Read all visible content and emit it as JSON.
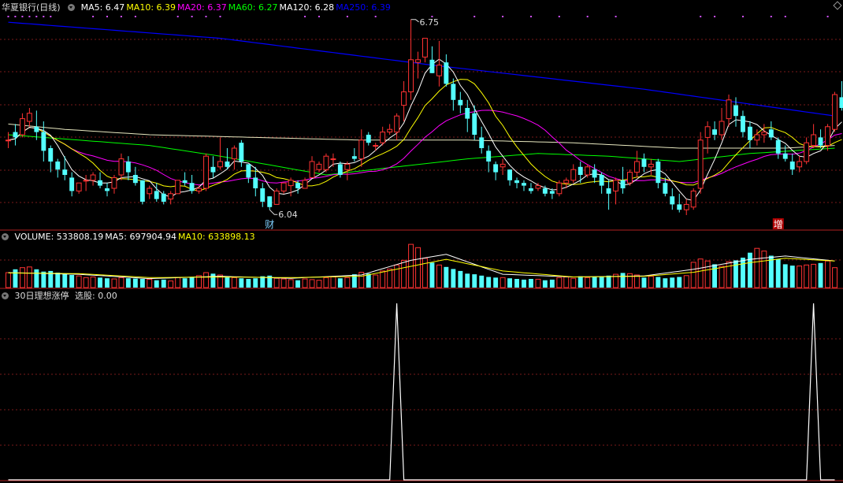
{
  "main": {
    "title": "华夏银行(日线)",
    "ma_labels": [
      {
        "name": "MA5: ",
        "value": "6.47",
        "color": "#ffffff"
      },
      {
        "name": "MA10: ",
        "value": "6.39",
        "color": "#ffff00"
      },
      {
        "name": "MA20: ",
        "value": "6.37",
        "color": "#ff00ff"
      },
      {
        "name": "MA60: ",
        "value": "6.27",
        "color": "#00ff00"
      },
      {
        "name": "MA120: ",
        "value": "6.28",
        "color": "#ffffff"
      },
      {
        "name": "MA250: ",
        "value": "6.39",
        "color": "#0000ff"
      }
    ]
  },
  "volume_panel": {
    "labels": [
      {
        "name": "VOLUME: ",
        "value": "533808.19",
        "color": "#ffffff"
      },
      {
        "name": "MA5: ",
        "value": "697904.94",
        "color": "#ffffff"
      },
      {
        "name": "MA10: ",
        "value": "633898.13",
        "color": "#ffff00"
      }
    ]
  },
  "indicator_panel": {
    "title": "30日理想涨停",
    "label": "选股: ",
    "value": "0.00"
  },
  "chart_data": [
    {
      "type": "candlestick",
      "x_count": 118,
      "annotations": [
        {
          "label": "6.75",
          "kind": "high",
          "index": 57
        },
        {
          "label": "6.04",
          "kind": "low",
          "index": 37
        },
        {
          "label": "财",
          "kind": "event",
          "index": 37
        },
        {
          "label": "增",
          "kind": "event",
          "index": 109
        }
      ],
      "colors": {
        "up": "#ff3232",
        "down": "#54ffff",
        "ma5": "#ffffff",
        "ma10": "#ffff00",
        "ma20": "#ff00ff",
        "ma60": "#00ff00",
        "ma120": "#ffffff",
        "ma250": "#0000ff"
      },
      "ohlc": [
        [
          6.3,
          6.33,
          6.27,
          6.3
        ],
        [
          6.33,
          6.36,
          6.28,
          6.31
        ],
        [
          6.32,
          6.4,
          6.31,
          6.38
        ],
        [
          6.37,
          6.42,
          6.35,
          6.4
        ],
        [
          6.35,
          6.41,
          6.3,
          6.33
        ],
        [
          6.33,
          6.37,
          6.22,
          6.26
        ],
        [
          6.27,
          6.28,
          6.18,
          6.22
        ],
        [
          6.22,
          6.23,
          6.16,
          6.19
        ],
        [
          6.19,
          6.24,
          6.15,
          6.17
        ],
        [
          6.16,
          6.18,
          6.09,
          6.11
        ],
        [
          6.11,
          6.14,
          6.1,
          6.14
        ],
        [
          6.15,
          6.17,
          6.11,
          6.15
        ],
        [
          6.15,
          6.18,
          6.13,
          6.17
        ],
        [
          6.15,
          6.18,
          6.12,
          6.13
        ],
        [
          6.12,
          6.14,
          6.09,
          6.11
        ],
        [
          6.12,
          6.17,
          6.1,
          6.16
        ],
        [
          6.17,
          6.25,
          6.15,
          6.23
        ],
        [
          6.22,
          6.24,
          6.15,
          6.18
        ],
        [
          6.17,
          6.2,
          6.13,
          6.14
        ],
        [
          6.15,
          6.15,
          6.06,
          6.07
        ],
        [
          6.1,
          6.13,
          6.08,
          6.12
        ],
        [
          6.11,
          6.14,
          6.07,
          6.08
        ],
        [
          6.1,
          6.11,
          6.06,
          6.07
        ],
        [
          6.08,
          6.11,
          6.06,
          6.1
        ],
        [
          6.1,
          6.15,
          6.1,
          6.15
        ],
        [
          6.15,
          6.18,
          6.13,
          6.14
        ],
        [
          6.14,
          6.17,
          6.1,
          6.11
        ],
        [
          6.11,
          6.13,
          6.1,
          6.12
        ],
        [
          6.12,
          6.25,
          6.11,
          6.24
        ],
        [
          6.2,
          6.24,
          6.16,
          6.18
        ],
        [
          6.2,
          6.31,
          6.19,
          6.22
        ],
        [
          6.22,
          6.27,
          6.19,
          6.2
        ],
        [
          6.23,
          6.28,
          6.19,
          6.27
        ],
        [
          6.29,
          6.3,
          6.2,
          6.22
        ],
        [
          6.21,
          6.21,
          6.14,
          6.16
        ],
        [
          6.16,
          6.2,
          6.09,
          6.12
        ],
        [
          6.12,
          6.14,
          6.05,
          6.07
        ],
        [
          6.09,
          6.09,
          6.04,
          6.05
        ],
        [
          6.06,
          6.12,
          6.06,
          6.11
        ],
        [
          6.11,
          6.14,
          6.1,
          6.14
        ],
        [
          6.13,
          6.16,
          6.09,
          6.15
        ],
        [
          6.14,
          6.15,
          6.1,
          6.12
        ],
        [
          6.12,
          6.16,
          6.12,
          6.15
        ],
        [
          6.16,
          6.24,
          6.16,
          6.22
        ],
        [
          6.19,
          6.22,
          6.18,
          6.21
        ],
        [
          6.19,
          6.25,
          6.18,
          6.24
        ],
        [
          6.23,
          6.25,
          6.2,
          6.23
        ],
        [
          6.21,
          6.22,
          6.16,
          6.17
        ],
        [
          6.19,
          6.22,
          6.15,
          6.21
        ],
        [
          6.24,
          6.27,
          6.22,
          6.23
        ],
        [
          6.23,
          6.34,
          6.2,
          6.3
        ],
        [
          6.32,
          6.33,
          6.28,
          6.29
        ],
        [
          6.28,
          6.29,
          6.26,
          6.28
        ],
        [
          6.29,
          6.35,
          6.28,
          6.33
        ],
        [
          6.33,
          6.36,
          6.32,
          6.34
        ],
        [
          6.33,
          6.4,
          6.3,
          6.39
        ],
        [
          6.43,
          6.52,
          6.37,
          6.48
        ],
        [
          6.48,
          6.75,
          6.45,
          6.6
        ],
        [
          6.59,
          6.63,
          6.53,
          6.6
        ],
        [
          6.61,
          6.68,
          6.59,
          6.68
        ],
        [
          6.6,
          6.65,
          6.55,
          6.55
        ],
        [
          6.54,
          6.67,
          6.5,
          6.58
        ],
        [
          6.59,
          6.62,
          6.5,
          6.51
        ],
        [
          6.51,
          6.53,
          6.41,
          6.45
        ],
        [
          6.45,
          6.48,
          6.4,
          6.43
        ],
        [
          6.42,
          6.45,
          6.33,
          6.38
        ],
        [
          6.4,
          6.43,
          6.3,
          6.32
        ],
        [
          6.31,
          6.35,
          6.25,
          6.27
        ],
        [
          6.26,
          6.28,
          6.18,
          6.22
        ],
        [
          6.21,
          6.22,
          6.15,
          6.18
        ],
        [
          6.2,
          6.23,
          6.17,
          6.21
        ],
        [
          6.19,
          6.19,
          6.13,
          6.15
        ],
        [
          6.15,
          6.16,
          6.12,
          6.14
        ],
        [
          6.14,
          6.15,
          6.11,
          6.13
        ],
        [
          6.12,
          6.14,
          6.1,
          6.11
        ],
        [
          6.12,
          6.14,
          6.11,
          6.13
        ],
        [
          6.12,
          6.13,
          6.09,
          6.1
        ],
        [
          6.11,
          6.12,
          6.08,
          6.1
        ],
        [
          6.1,
          6.15,
          6.09,
          6.14
        ],
        [
          6.14,
          6.16,
          6.12,
          6.15
        ],
        [
          6.15,
          6.21,
          6.14,
          6.19
        ],
        [
          6.2,
          6.22,
          6.14,
          6.17
        ],
        [
          6.17,
          6.21,
          6.16,
          6.2
        ],
        [
          6.19,
          6.21,
          6.14,
          6.16
        ],
        [
          6.17,
          6.18,
          6.1,
          6.13
        ],
        [
          6.12,
          6.15,
          6.04,
          6.1
        ],
        [
          6.11,
          6.16,
          6.06,
          6.15
        ],
        [
          6.15,
          6.2,
          6.1,
          6.12
        ],
        [
          6.14,
          6.19,
          6.13,
          6.18
        ],
        [
          6.18,
          6.26,
          6.16,
          6.22
        ],
        [
          6.23,
          6.25,
          6.18,
          6.2
        ],
        [
          6.2,
          6.23,
          6.17,
          6.21
        ],
        [
          6.22,
          6.23,
          6.12,
          6.14
        ],
        [
          6.14,
          6.16,
          6.09,
          6.1
        ],
        [
          6.09,
          6.12,
          6.04,
          6.06
        ],
        [
          6.06,
          6.1,
          6.03,
          6.04
        ],
        [
          6.04,
          6.08,
          6.02,
          6.06
        ],
        [
          6.05,
          6.12,
          6.04,
          6.11
        ],
        [
          6.12,
          6.33,
          6.1,
          6.3
        ],
        [
          6.31,
          6.37,
          6.25,
          6.35
        ],
        [
          6.34,
          6.37,
          6.3,
          6.32
        ],
        [
          6.32,
          6.42,
          6.3,
          6.37
        ],
        [
          6.38,
          6.47,
          6.35,
          6.45
        ],
        [
          6.43,
          6.46,
          6.35,
          6.39
        ],
        [
          6.39,
          6.41,
          6.31,
          6.33
        ],
        [
          6.35,
          6.37,
          6.27,
          6.3
        ],
        [
          6.3,
          6.34,
          6.28,
          6.32
        ],
        [
          6.32,
          6.36,
          6.29,
          6.33
        ],
        [
          6.34,
          6.37,
          6.3,
          6.31
        ],
        [
          6.3,
          6.31,
          6.23,
          6.25
        ],
        [
          6.25,
          6.28,
          6.22,
          6.23
        ],
        [
          6.22,
          6.25,
          6.17,
          6.19
        ],
        [
          6.2,
          6.24,
          6.18,
          6.22
        ],
        [
          6.22,
          6.31,
          6.21,
          6.29
        ],
        [
          6.28,
          6.36,
          6.27,
          6.32
        ],
        [
          6.31,
          6.34,
          6.27,
          6.28
        ],
        [
          6.28,
          6.36,
          6.26,
          6.35
        ],
        [
          6.34,
          6.48,
          6.33,
          6.47
        ],
        [
          6.46,
          6.52,
          6.41,
          6.42
        ]
      ],
      "ma_lines": {
        "ma250": [
          [
            0,
            6.74
          ],
          [
            30,
            6.68
          ],
          [
            60,
            6.58
          ],
          [
            90,
            6.49
          ],
          [
            117,
            6.39
          ]
        ],
        "ma120": [
          [
            0,
            6.36
          ],
          [
            8,
            6.34
          ],
          [
            20,
            6.32
          ],
          [
            35,
            6.31
          ],
          [
            50,
            6.3
          ],
          [
            65,
            6.3
          ],
          [
            80,
            6.29
          ],
          [
            95,
            6.27
          ],
          [
            110,
            6.27
          ],
          [
            117,
            6.28
          ]
        ],
        "ma60": [
          [
            0,
            6.32
          ],
          [
            10,
            6.3
          ],
          [
            20,
            6.28
          ],
          [
            30,
            6.24
          ],
          [
            45,
            6.17
          ],
          [
            55,
            6.2
          ],
          [
            65,
            6.23
          ],
          [
            75,
            6.25
          ],
          [
            85,
            6.24
          ],
          [
            95,
            6.22
          ],
          [
            105,
            6.25
          ],
          [
            117,
            6.27
          ]
        ]
      }
    },
    {
      "type": "bar",
      "x_count": 118,
      "up_color": "#ff3232",
      "down_color": "#54ffff",
      "volume_10k": [
        45,
        55,
        60,
        62,
        55,
        48,
        50,
        45,
        42,
        38,
        35,
        30,
        32,
        30,
        28,
        26,
        30,
        28,
        27,
        26,
        25,
        22,
        24,
        20,
        30,
        28,
        32,
        36,
        45,
        42,
        38,
        32,
        30,
        28,
        26,
        28,
        34,
        36,
        28,
        26,
        24,
        22,
        26,
        24,
        22,
        30,
        32,
        28,
        30,
        40,
        46,
        42,
        38,
        50,
        56,
        68,
        82,
        130,
        120,
        88,
        75,
        68,
        62,
        56,
        50,
        42,
        40,
        36,
        32,
        30,
        30,
        28,
        26,
        24,
        26,
        25,
        22,
        24,
        30,
        32,
        28,
        34,
        30,
        32,
        34,
        36,
        40,
        44,
        42,
        38,
        30,
        34,
        32,
        28,
        30,
        32,
        36,
        76,
        86,
        80,
        70,
        64,
        78,
        82,
        90,
        105,
        118,
        110,
        96,
        85,
        70,
        66,
        65,
        68,
        70,
        74,
        80,
        60
      ],
      "ma5": [
        [
          0,
          45
        ],
        [
          10,
          40
        ],
        [
          20,
          27
        ],
        [
          30,
          34
        ],
        [
          40,
          28
        ],
        [
          50,
          38
        ],
        [
          57,
          82
        ],
        [
          62,
          100
        ],
        [
          70,
          40
        ],
        [
          80,
          32
        ],
        [
          90,
          35
        ],
        [
          97,
          55
        ],
        [
          105,
          85
        ],
        [
          110,
          95
        ],
        [
          117,
          80
        ]
      ],
      "ma10": [
        [
          0,
          44
        ],
        [
          10,
          42
        ],
        [
          20,
          30
        ],
        [
          30,
          32
        ],
        [
          40,
          30
        ],
        [
          50,
          34
        ],
        [
          57,
          64
        ],
        [
          62,
          85
        ],
        [
          70,
          50
        ],
        [
          80,
          32
        ],
        [
          90,
          34
        ],
        [
          97,
          46
        ],
        [
          105,
          75
        ],
        [
          110,
          88
        ],
        [
          117,
          80
        ]
      ]
    },
    {
      "type": "line",
      "name": "选股",
      "x_count": 118,
      "values_nonzero": [
        {
          "index": 55,
          "value": 1
        },
        {
          "index": 114,
          "value": 1
        }
      ],
      "default": 0,
      "ylim": [
        0,
        1
      ]
    }
  ]
}
